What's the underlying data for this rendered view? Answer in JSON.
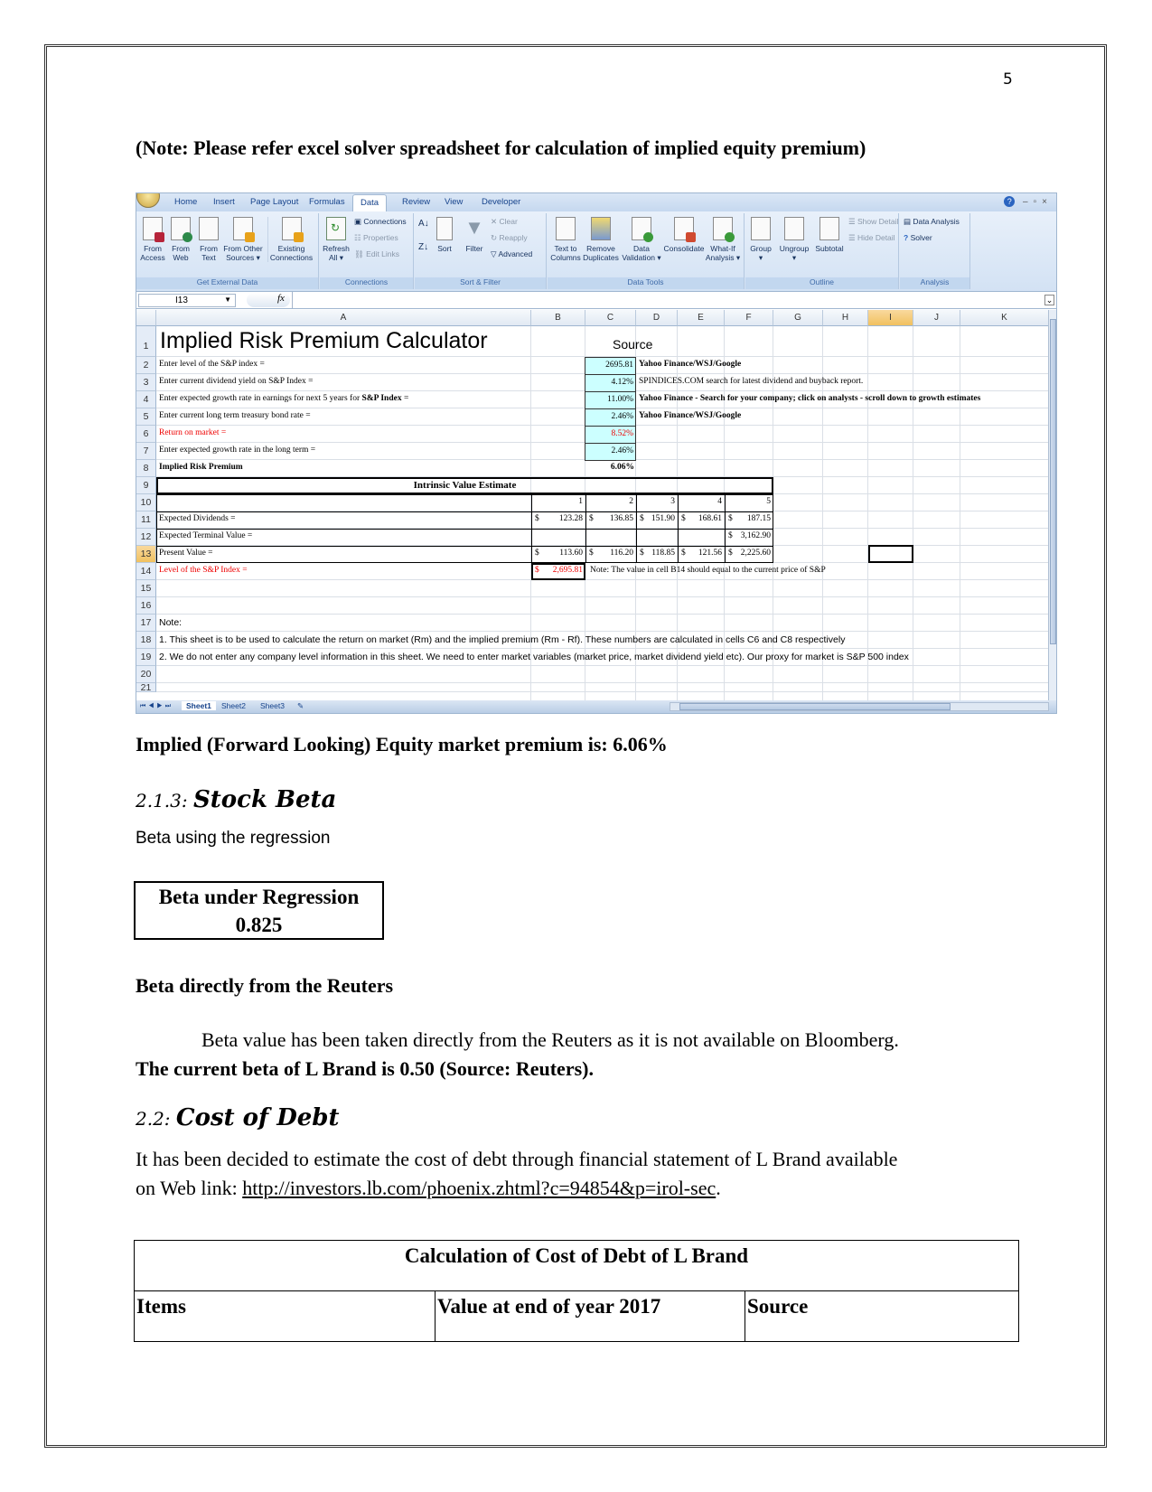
{
  "page": {
    "number": "5"
  },
  "note": "(Note: Please refer excel solver spreadsheet for calculation of implied equity premium)",
  "excel": {
    "tabs": [
      "Home",
      "Insert",
      "Page Layout",
      "Formulas",
      "Data",
      "Review",
      "View",
      "Developer"
    ],
    "active_tab": "Data",
    "ribbon": {
      "get_external_data": {
        "label": "Get External Data",
        "buttons": [
          "From\nAccess",
          "From\nWeb",
          "From\nText",
          "From Other\nSources ▾",
          "Existing\nConnections"
        ]
      },
      "connections": {
        "label": "Connections",
        "refresh": "Refresh\nAll ▾",
        "items": [
          "Connections",
          "Properties",
          "Edit Links"
        ]
      },
      "sort_filter": {
        "label": "Sort & Filter",
        "sort": "Sort",
        "filter": "Filter",
        "items": [
          "Clear",
          "Reapply",
          "Advanced"
        ]
      },
      "data_tools": {
        "label": "Data Tools",
        "buttons": [
          "Text to\nColumns",
          "Remove\nDuplicates",
          "Data\nValidation ▾",
          "Consolidate",
          "What-If\nAnalysis ▾"
        ]
      },
      "outline": {
        "label": "Outline",
        "buttons": [
          "Group\n▾",
          "Ungroup\n▾",
          "Subtotal"
        ],
        "items": [
          "Show Detail",
          "Hide Detail"
        ]
      },
      "analysis": {
        "label": "Analysis",
        "items": [
          "Data Analysis",
          "Solver"
        ]
      }
    },
    "name_box": "I13",
    "fx_label": "fx",
    "columns": [
      "A",
      "B",
      "C",
      "D",
      "E",
      "F",
      "G",
      "H",
      "I",
      "J",
      "K"
    ],
    "selected_column": "I",
    "selected_row": "13",
    "rows": [
      "1",
      "2",
      "3",
      "4",
      "5",
      "6",
      "7",
      "8",
      "9",
      "10",
      "11",
      "12",
      "13",
      "14",
      "15",
      "16",
      "17",
      "18",
      "19",
      "20",
      "21"
    ],
    "title": "Implied Risk Premium Calculator",
    "source_header": "Source",
    "inputs": [
      {
        "label": "Enter level of the S&P index =",
        "value": "2695.81",
        "source": "Yahoo Finance/WSJ/Google"
      },
      {
        "label": "Enter current dividend yield on S&P Index =",
        "value": "4.12%",
        "source": "SPINDICES.COM search for latest dividend and buyback report."
      },
      {
        "label_pre": "Enter expected growth rate in earnings for next 5 years for ",
        "label_bold": "S&P Index",
        "label_post": " =",
        "value": "11.00%",
        "source_bold": "Yahoo Finance - Search for your company; click on analysts - scroll down to growth estimates"
      },
      {
        "label": "Enter current long term treasury bond rate =",
        "value": "2.46%",
        "source": "Yahoo Finance/WSJ/Google"
      },
      {
        "label": "Return on market =",
        "value": "8.52%"
      },
      {
        "label": "Enter expected growth rate in the long term =",
        "value": "2.46%"
      }
    ],
    "implied_label": "Implied Risk Premium",
    "implied_value": "6.06%",
    "intrinsic_header": "Intrinsic Value Estimate",
    "years": [
      "1",
      "2",
      "3",
      "4",
      "5"
    ],
    "expected_dividends_label": "Expected Dividends =",
    "expected_dividends": [
      "123.28",
      "136.85",
      "151.90",
      "168.61",
      "187.15"
    ],
    "terminal_label": "Expected Terminal Value =",
    "terminal_value": "3,162.90",
    "present_value_label": "Present Value =",
    "present_values": [
      "113.60",
      "116.20",
      "118.85",
      "121.56",
      "2,225.60"
    ],
    "level_label": "Level of the S&P Index =",
    "level_value": "2,695.81",
    "currency": "$",
    "b14_note": "Note: The value in cell B14 should equal to the current price of S&P",
    "note_label": "Note:",
    "note_1": "1. This sheet is to be used to calculate the return on market (Rm) and the implied premium (Rm - Rf). These numbers are calculated in cells C6 and C8 respectively",
    "note_2": "2. We do not enter any company level information in this sheet. We need to enter market variables (market price, market dividend yield etc). Our proxy for market is S&P 500 index",
    "sheets": [
      "Sheet1",
      "Sheet2",
      "Sheet3"
    ],
    "active_sheet": "Sheet1"
  },
  "implied_statement": "Implied (Forward Looking) Equity market premium is: 6.06%",
  "stock_beta": {
    "number": "2.1.3:",
    "title": "Stock Beta",
    "intro": "Beta using the regression",
    "box_title": "Beta under Regression",
    "box_value": "0.825"
  },
  "reuters": {
    "heading": "Beta directly from the Reuters",
    "para": "Beta value has been taken directly from the Reuters as it is not available on Bloomberg.",
    "bold_line": "The current beta of L Brand is 0.50 (Source: Reuters)."
  },
  "cost_of_debt": {
    "number": "2.2:",
    "title": "Cost of Debt",
    "para_1": "It has been decided to estimate the cost of debt through financial statement of L Brand available",
    "para_2_pre": "on Web link: ",
    "link": "http://investors.lb.com/phoenix.zhtml?c=94854&p=irol-sec",
    "para_2_post": ".",
    "table_title": "Calculation of Cost of Debt of L Brand",
    "columns": [
      "Items",
      "Value at end of year 2017",
      "Source"
    ]
  }
}
